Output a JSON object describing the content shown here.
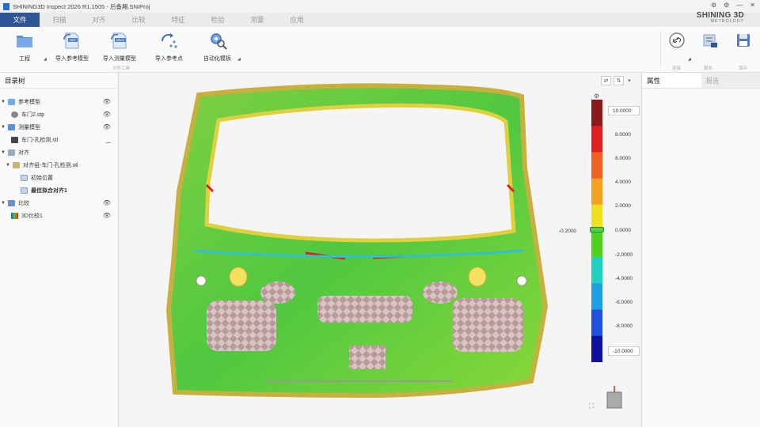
{
  "window": {
    "title": "SHINING3D Inspect 2026 R1.1505 - 后备厢.SNIProj",
    "brand_main": "SHINING 3D",
    "brand_sub": "METROLOGY",
    "controls": [
      "⚙",
      "⚙",
      "—",
      "✕"
    ]
  },
  "menu": [
    {
      "label": "文件",
      "active": true
    },
    {
      "label": "扫描"
    },
    {
      "label": "对齐"
    },
    {
      "label": "比较"
    },
    {
      "label": "特征"
    },
    {
      "label": "检验"
    },
    {
      "label": "测量"
    },
    {
      "label": "应用"
    }
  ],
  "ribbon": {
    "project_label": "工程",
    "import_ref_label": "导入参考模型",
    "import_meas_label": "导入测量模型",
    "import_point_label": "导入参考点",
    "automate_label": "自动化模板",
    "group_label": "文件工具",
    "right_group_1": "连接",
    "right_group_2": "服务",
    "right_group_3": "保存",
    "ref_badge": "REF",
    "meas_badge": "MEAS"
  },
  "tree": {
    "title": "目录树",
    "items": [
      {
        "label": "参考模型"
      },
      {
        "label": "车门2.stp"
      },
      {
        "label": "测量模型"
      },
      {
        "label": "车门-孔检测.stl"
      },
      {
        "label": "对齐"
      },
      {
        "label": "对齐组-车门-孔检测.stl"
      },
      {
        "label": "初始位置"
      },
      {
        "label": "最佳拟合对齐1"
      },
      {
        "label": "比较"
      },
      {
        "label": "3D比较1"
      }
    ]
  },
  "color_scale": {
    "max": "10.0000",
    "min": "-10.0000",
    "side_value": "-0.2000",
    "ticks": [
      "8.0000",
      "6.0000",
      "4.0000",
      "2.0000",
      "0.0000",
      "-2.0000",
      "-4.0000",
      "-6.0000",
      "-8.0000"
    ],
    "colors": [
      "#8b1a1a",
      "#e02020",
      "#f06020",
      "#f5a020",
      "#f0e020",
      "#50d020",
      "#20d0c0",
      "#20a0e0",
      "#2050e0",
      "#1010a0"
    ]
  },
  "right_panel": {
    "tab_properties": "属性",
    "tab_report": "报告"
  }
}
